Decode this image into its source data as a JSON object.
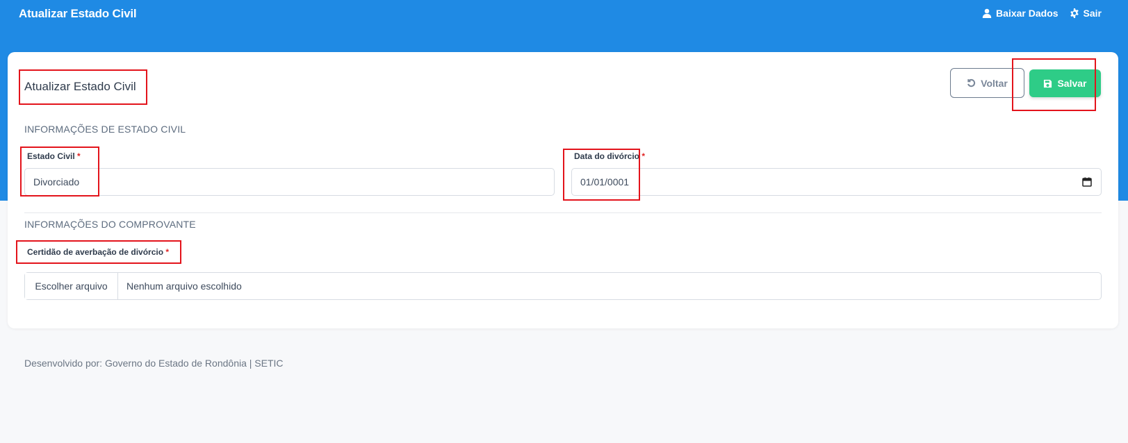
{
  "header": {
    "title": "Atualizar Estado Civil",
    "download_label": "Baixar Dados",
    "logout_label": "Sair"
  },
  "card": {
    "title": "Atualizar Estado Civil",
    "back_label": "Voltar",
    "save_label": "Salvar"
  },
  "section_civil": {
    "title": "INFORMAÇÕES DE ESTADO CIVIL",
    "estado_civil_label": "Estado Civil",
    "estado_civil_value": "Divorciado",
    "data_divorcio_label": "Data do divórcio",
    "data_divorcio_value": "01/01/0001"
  },
  "section_proof": {
    "title": "INFORMAÇÕES DO COMPROVANTE",
    "certidao_label": "Certidão de averbação de divórcio",
    "file_button_label": "Escolher arquivo",
    "file_status": "Nenhum arquivo escolhido"
  },
  "required_mark": "*",
  "footer": {
    "text": "Desenvolvido por: Governo do Estado de Rondônia | SETIC"
  },
  "colors": {
    "header_bg": "#1f8ae4",
    "save_button": "#2ecc87",
    "required": "#e02424",
    "highlight_box": "#e3131b"
  }
}
